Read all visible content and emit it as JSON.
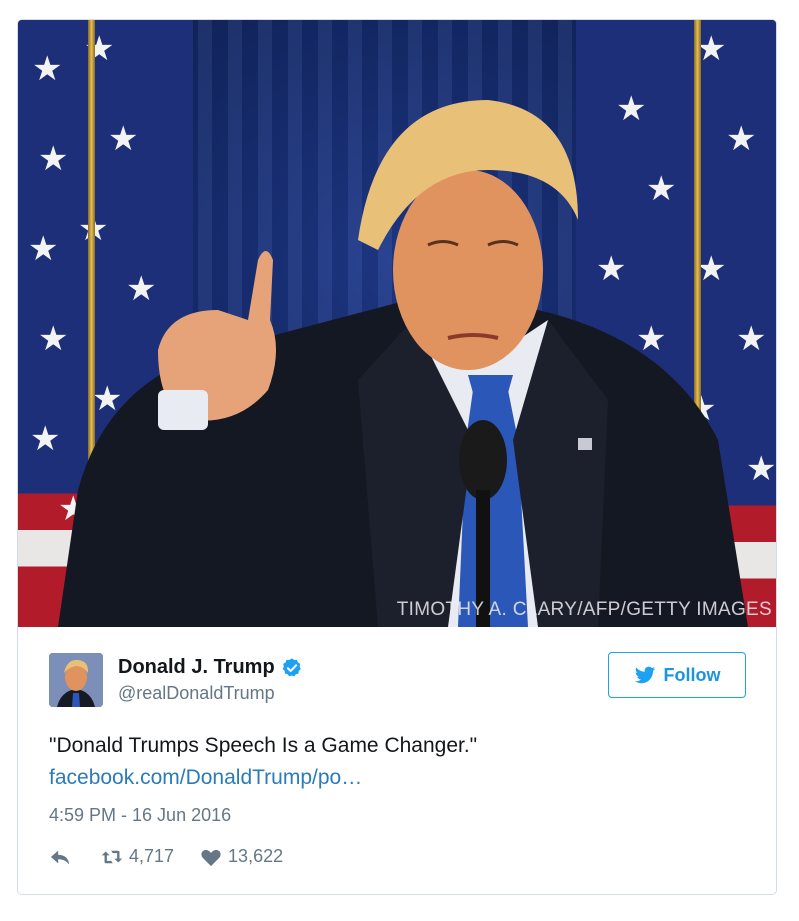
{
  "photo": {
    "credit": "TIMOTHY A. CLARY/AFP/GETTY IMAGES"
  },
  "author": {
    "name": "Donald J. Trump",
    "handle": "@realDonaldTrump",
    "verified": true
  },
  "follow_button": {
    "label": "Follow",
    "icon": "twitter-bird-icon"
  },
  "tweet": {
    "text": "\"Donald Trumps Speech Is a Game Changer.\"",
    "link": "facebook.com/DonaldTrump/po…",
    "timestamp": "4:59 PM - 16 Jun 2016"
  },
  "actions": {
    "reply_icon": "reply-icon",
    "retweet_icon": "retweet-icon",
    "retweets": "4,717",
    "like_icon": "heart-icon",
    "likes": "13,622"
  },
  "colors": {
    "brand": "#1da1f2",
    "link": "#2b7bb9",
    "muted": "#657786",
    "text": "#14171a"
  }
}
